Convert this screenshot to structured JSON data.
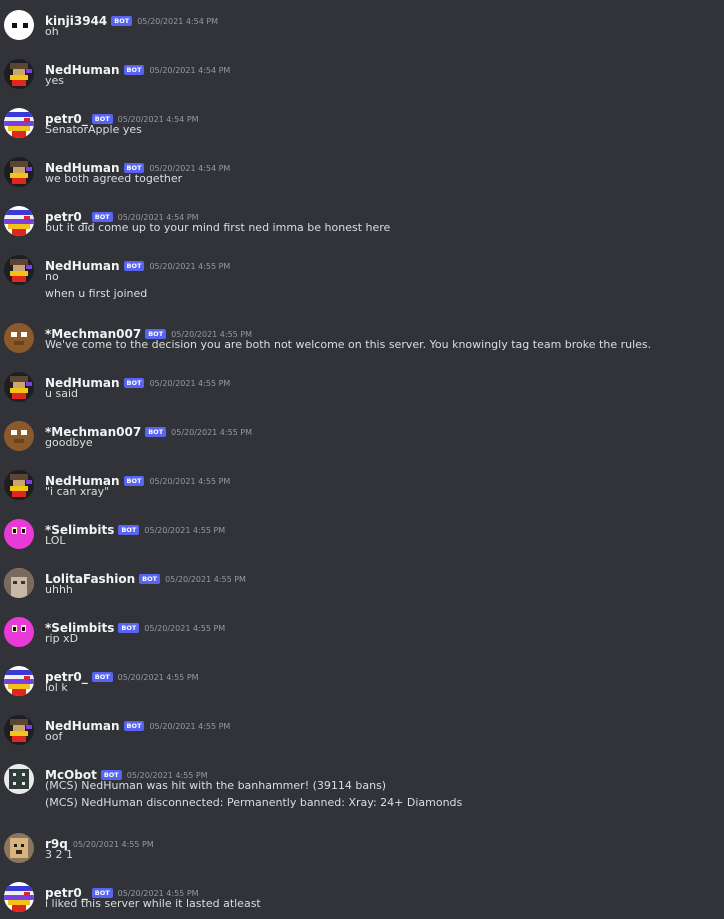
{
  "bot_tag": "BOT",
  "messages": [
    {
      "author": "kinji3944",
      "bot": true,
      "time": "05/20/2021 4:54 PM",
      "avatar": "kinji",
      "lines": [
        "oh"
      ]
    },
    {
      "author": "NedHuman",
      "bot": true,
      "time": "05/20/2021 4:54 PM",
      "avatar": "ned",
      "lines": [
        "yes"
      ]
    },
    {
      "author": "petr0_",
      "bot": true,
      "time": "05/20/2021 4:54 PM",
      "avatar": "petr",
      "lines": [
        "SenatorApple yes"
      ]
    },
    {
      "author": "NedHuman",
      "bot": true,
      "time": "05/20/2021 4:54 PM",
      "avatar": "ned",
      "lines": [
        "we both agreed together"
      ]
    },
    {
      "author": "petr0_",
      "bot": true,
      "time": "05/20/2021 4:54 PM",
      "avatar": "petr",
      "lines": [
        "but it did come up to your mind first ned imma be honest here"
      ]
    },
    {
      "author": "NedHuman",
      "bot": true,
      "time": "05/20/2021 4:55 PM",
      "avatar": "ned",
      "lines": [
        "no",
        "when u first joined"
      ]
    },
    {
      "author": "*Mechman007",
      "bot": true,
      "time": "05/20/2021 4:55 PM",
      "avatar": "mech",
      "lines": [
        "We've come to the decision you are both not welcome on this server. You knowingly tag team broke the rules."
      ]
    },
    {
      "author": "NedHuman",
      "bot": true,
      "time": "05/20/2021 4:55 PM",
      "avatar": "ned",
      "lines": [
        "u said"
      ]
    },
    {
      "author": "*Mechman007",
      "bot": true,
      "time": "05/20/2021 4:55 PM",
      "avatar": "mech",
      "lines": [
        "goodbye"
      ]
    },
    {
      "author": "NedHuman",
      "bot": true,
      "time": "05/20/2021 4:55 PM",
      "avatar": "ned",
      "lines": [
        "\"i can xray\""
      ]
    },
    {
      "author": "*Selimbits",
      "bot": true,
      "time": "05/20/2021 4:55 PM",
      "avatar": "seli",
      "lines": [
        "LOL"
      ]
    },
    {
      "author": "LolitaFashion",
      "bot": true,
      "time": "05/20/2021 4:55 PM",
      "avatar": "loli",
      "lines": [
        "uhhh"
      ]
    },
    {
      "author": "*Selimbits",
      "bot": true,
      "time": "05/20/2021 4:55 PM",
      "avatar": "seli",
      "lines": [
        "rip xD"
      ]
    },
    {
      "author": "petr0_",
      "bot": true,
      "time": "05/20/2021 4:55 PM",
      "avatar": "petr",
      "lines": [
        "lol k"
      ]
    },
    {
      "author": "NedHuman",
      "bot": true,
      "time": "05/20/2021 4:55 PM",
      "avatar": "ned",
      "lines": [
        "oof"
      ]
    },
    {
      "author": "McObot",
      "bot": true,
      "time": "05/20/2021 4:55 PM",
      "avatar": "mcobot",
      "lines": [
        "(MCS) NedHuman was hit with the banhammer! (39114 bans)",
        "(MCS) NedHuman disconnected: Permanently banned: Xray: 24+ Diamonds"
      ]
    },
    {
      "author": "r9q",
      "bot": false,
      "time": "05/20/2021 4:55 PM",
      "avatar": "r9q",
      "lines": [
        "3 2 1"
      ]
    },
    {
      "author": "petr0_",
      "bot": true,
      "time": "05/20/2021 4:55 PM",
      "avatar": "petr",
      "lines": [
        "i liked this server while it lasted atleast"
      ]
    }
  ]
}
